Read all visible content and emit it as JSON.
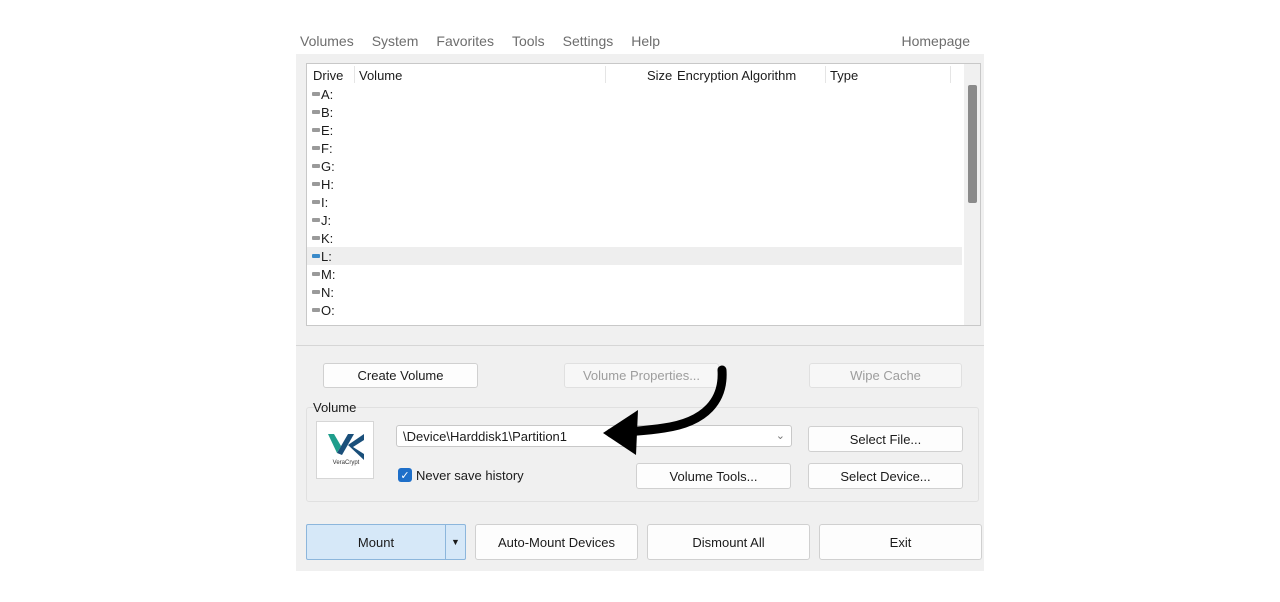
{
  "menu": {
    "items": [
      "Volumes",
      "System",
      "Favorites",
      "Tools",
      "Settings",
      "Help"
    ],
    "homepage": "Homepage"
  },
  "list": {
    "columns": {
      "drive": "Drive",
      "volume": "Volume",
      "size": "Size",
      "algorithm": "Encryption Algorithm",
      "type": "Type"
    },
    "drives": [
      "A:",
      "B:",
      "E:",
      "F:",
      "G:",
      "H:",
      "I:",
      "J:",
      "K:",
      "L:",
      "M:",
      "N:",
      "O:"
    ],
    "selected": "L:"
  },
  "buttons": {
    "create_volume": "Create Volume",
    "volume_properties": "Volume Properties...",
    "wipe_cache": "Wipe Cache",
    "select_file": "Select File...",
    "volume_tools": "Volume Tools...",
    "select_device": "Select Device...",
    "mount": "Mount",
    "auto_mount": "Auto-Mount Devices",
    "dismount_all": "Dismount All",
    "exit": "Exit"
  },
  "volume": {
    "group_label": "Volume",
    "path": "\\Device\\Harddisk1\\Partition1",
    "never_save_history": "Never save history",
    "never_save_checked": true,
    "logo_text": "VeraCrypt"
  },
  "colors": {
    "accent": "#1e6fc9",
    "selected_drive": "#3a8ac9",
    "logo_green": "#1f9e8c",
    "logo_blue": "#1a4f7a"
  }
}
